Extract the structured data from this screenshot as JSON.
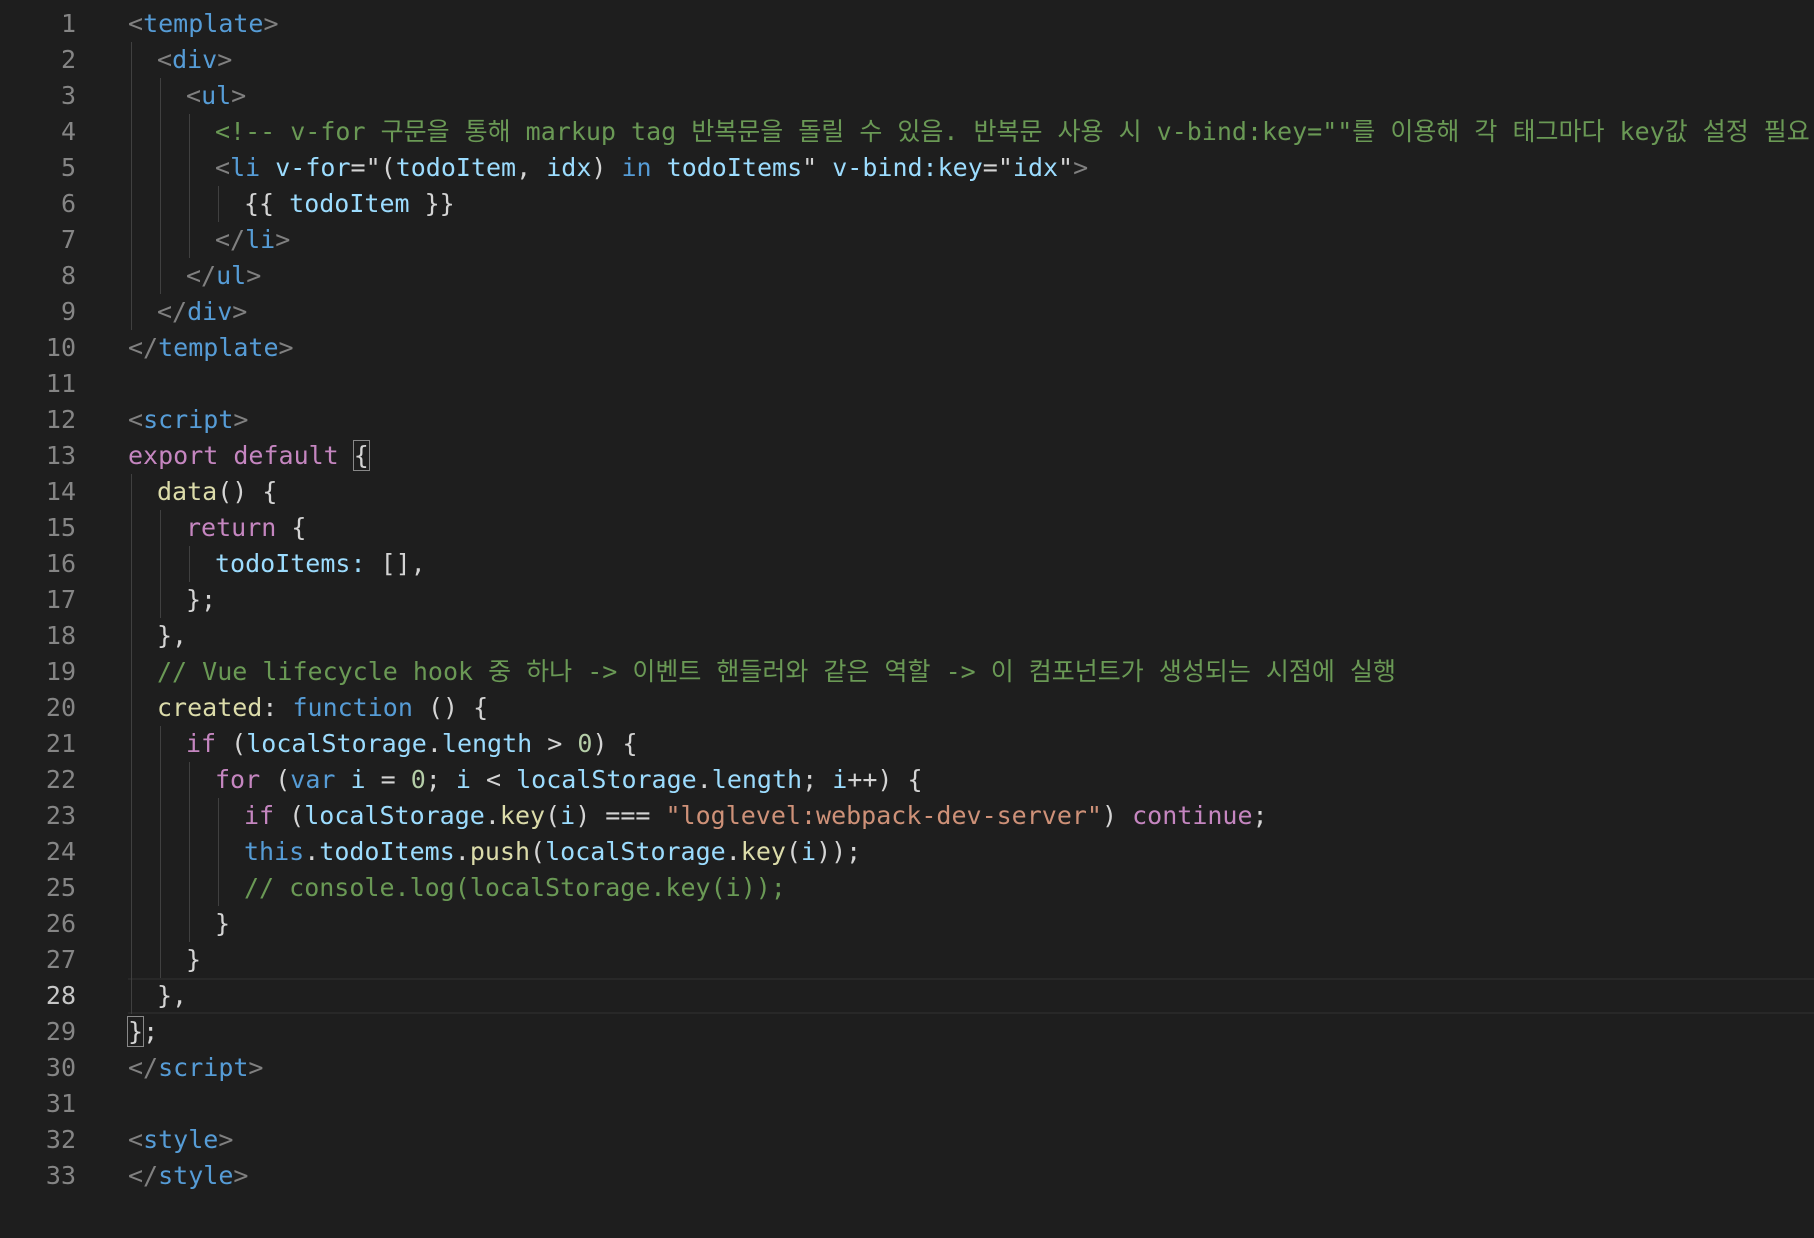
{
  "editor": {
    "language": "vue",
    "active_line": 28,
    "colors": {
      "background": "#1e1e1e",
      "line_number": "#858585",
      "tag": "#569cd6",
      "attribute": "#9cdcfe",
      "string": "#ce9178",
      "comment": "#6a9955",
      "keyword": "#c586c0",
      "function": "#dcdcaa"
    },
    "lines": [
      {
        "num": "1",
        "indent": 0,
        "tokens": [
          [
            "tag-p",
            "<"
          ],
          [
            "tag-n",
            "template"
          ],
          [
            "tag-p",
            ">"
          ]
        ]
      },
      {
        "num": "2",
        "indent": 1,
        "tokens": [
          [
            "tag-p",
            "<"
          ],
          [
            "tag-n",
            "div"
          ],
          [
            "tag-p",
            ">"
          ]
        ]
      },
      {
        "num": "3",
        "indent": 2,
        "tokens": [
          [
            "tag-p",
            "<"
          ],
          [
            "tag-n",
            "ul"
          ],
          [
            "tag-p",
            ">"
          ]
        ]
      },
      {
        "num": "4",
        "indent": 3,
        "tokens": [
          [
            "cmt",
            "<!-- v-for 구문을 통해 markup tag 반복문을 돌릴 수 있음. 반복문 사용 시 v-bind:key=\"\"를 이용해 각 태그마다 key값 설정 필요 -->"
          ]
        ]
      },
      {
        "num": "5",
        "indent": 3,
        "tokens": [
          [
            "tag-p",
            "<"
          ],
          [
            "tag-n",
            "li"
          ],
          [
            "txt",
            " "
          ],
          [
            "attr",
            "v-for"
          ],
          [
            "txt",
            "="
          ],
          [
            "txt",
            "\""
          ],
          [
            "txt",
            "("
          ],
          [
            "var",
            "todoItem"
          ],
          [
            "txt",
            ", "
          ],
          [
            "var",
            "idx"
          ],
          [
            "txt",
            ") "
          ],
          [
            "kw2",
            "in"
          ],
          [
            "txt",
            " "
          ],
          [
            "var",
            "todoItems"
          ],
          [
            "txt",
            "\""
          ],
          [
            "txt",
            " "
          ],
          [
            "attr",
            "v-bind:key"
          ],
          [
            "txt",
            "="
          ],
          [
            "txt",
            "\""
          ],
          [
            "var",
            "idx"
          ],
          [
            "txt",
            "\""
          ],
          [
            "tag-p",
            ">"
          ]
        ]
      },
      {
        "num": "6",
        "indent": 4,
        "tokens": [
          [
            "txt",
            "{{ "
          ],
          [
            "var",
            "todoItem"
          ],
          [
            "txt",
            " }}"
          ]
        ]
      },
      {
        "num": "7",
        "indent": 3,
        "tokens": [
          [
            "tag-p",
            "</"
          ],
          [
            "tag-n",
            "li"
          ],
          [
            "tag-p",
            ">"
          ]
        ]
      },
      {
        "num": "8",
        "indent": 2,
        "tokens": [
          [
            "tag-p",
            "</"
          ],
          [
            "tag-n",
            "ul"
          ],
          [
            "tag-p",
            ">"
          ]
        ]
      },
      {
        "num": "9",
        "indent": 1,
        "tokens": [
          [
            "tag-p",
            "</"
          ],
          [
            "tag-n",
            "div"
          ],
          [
            "tag-p",
            ">"
          ]
        ]
      },
      {
        "num": "10",
        "indent": 0,
        "tokens": [
          [
            "tag-p",
            "</"
          ],
          [
            "tag-n",
            "template"
          ],
          [
            "tag-p",
            ">"
          ]
        ]
      },
      {
        "num": "11",
        "indent": 0,
        "tokens": []
      },
      {
        "num": "12",
        "indent": 0,
        "tokens": [
          [
            "tag-p",
            "<"
          ],
          [
            "tag-n",
            "script"
          ],
          [
            "tag-p",
            ">"
          ]
        ]
      },
      {
        "num": "13",
        "indent": 0,
        "tokens": [
          [
            "kw",
            "export"
          ],
          [
            "txt",
            " "
          ],
          [
            "kw",
            "default"
          ],
          [
            "txt",
            " "
          ],
          [
            "box",
            "{"
          ]
        ]
      },
      {
        "num": "14",
        "indent": 1,
        "tokens": [
          [
            "fn",
            "data"
          ],
          [
            "txt",
            "() {"
          ]
        ]
      },
      {
        "num": "15",
        "indent": 2,
        "tokens": [
          [
            "kw",
            "return"
          ],
          [
            "txt",
            " {"
          ]
        ]
      },
      {
        "num": "16",
        "indent": 3,
        "tokens": [
          [
            "var",
            "todoItems"
          ],
          [
            "var",
            ":"
          ],
          [
            "txt",
            " [],"
          ]
        ]
      },
      {
        "num": "17",
        "indent": 2,
        "tokens": [
          [
            "txt",
            "};"
          ]
        ]
      },
      {
        "num": "18",
        "indent": 1,
        "tokens": [
          [
            "txt",
            "},"
          ]
        ]
      },
      {
        "num": "19",
        "indent": 1,
        "tokens": [
          [
            "cmt",
            "// Vue lifecycle hook 중 하나 -> 이벤트 핸들러와 같은 역할 -> 이 컴포넌트가 생성되는 시점에 실행"
          ]
        ]
      },
      {
        "num": "20",
        "indent": 1,
        "tokens": [
          [
            "fn",
            "created"
          ],
          [
            "txt",
            ": "
          ],
          [
            "kw2",
            "function"
          ],
          [
            "txt",
            " () {"
          ]
        ]
      },
      {
        "num": "21",
        "indent": 2,
        "tokens": [
          [
            "kw",
            "if"
          ],
          [
            "txt",
            " ("
          ],
          [
            "var",
            "localStorage"
          ],
          [
            "txt",
            "."
          ],
          [
            "var",
            "length"
          ],
          [
            "txt",
            " > "
          ],
          [
            "num",
            "0"
          ],
          [
            "txt",
            ") {"
          ]
        ]
      },
      {
        "num": "22",
        "indent": 3,
        "tokens": [
          [
            "kw",
            "for"
          ],
          [
            "txt",
            " ("
          ],
          [
            "kw2",
            "var"
          ],
          [
            "txt",
            " "
          ],
          [
            "var",
            "i"
          ],
          [
            "txt",
            " = "
          ],
          [
            "num",
            "0"
          ],
          [
            "txt",
            "; "
          ],
          [
            "var",
            "i"
          ],
          [
            "txt",
            " < "
          ],
          [
            "var",
            "localStorage"
          ],
          [
            "txt",
            "."
          ],
          [
            "var",
            "length"
          ],
          [
            "txt",
            "; "
          ],
          [
            "var",
            "i"
          ],
          [
            "txt",
            "++) {"
          ]
        ]
      },
      {
        "num": "23",
        "indent": 4,
        "tokens": [
          [
            "kw",
            "if"
          ],
          [
            "txt",
            " ("
          ],
          [
            "var",
            "localStorage"
          ],
          [
            "txt",
            "."
          ],
          [
            "fn",
            "key"
          ],
          [
            "txt",
            "("
          ],
          [
            "var",
            "i"
          ],
          [
            "txt",
            ") === "
          ],
          [
            "str",
            "\"loglevel:webpack-dev-server\""
          ],
          [
            "txt",
            ") "
          ],
          [
            "kw",
            "continue"
          ],
          [
            "txt",
            ";"
          ]
        ]
      },
      {
        "num": "24",
        "indent": 4,
        "tokens": [
          [
            "kw2",
            "this"
          ],
          [
            "txt",
            "."
          ],
          [
            "var",
            "todoItems"
          ],
          [
            "txt",
            "."
          ],
          [
            "fn",
            "push"
          ],
          [
            "txt",
            "("
          ],
          [
            "var",
            "localStorage"
          ],
          [
            "txt",
            "."
          ],
          [
            "fn",
            "key"
          ],
          [
            "txt",
            "("
          ],
          [
            "var",
            "i"
          ],
          [
            "txt",
            "));"
          ]
        ]
      },
      {
        "num": "25",
        "indent": 4,
        "tokens": [
          [
            "cmt",
            "// console.log(localStorage.key(i));"
          ]
        ]
      },
      {
        "num": "26",
        "indent": 3,
        "tokens": [
          [
            "txt",
            "}"
          ]
        ]
      },
      {
        "num": "27",
        "indent": 2,
        "tokens": [
          [
            "txt",
            "}"
          ]
        ]
      },
      {
        "num": "28",
        "indent": 1,
        "tokens": [
          [
            "txt",
            "},"
          ]
        ]
      },
      {
        "num": "29",
        "indent": 0,
        "tokens": [
          [
            "box",
            "}"
          ],
          [
            "txt",
            ";"
          ]
        ]
      },
      {
        "num": "30",
        "indent": 0,
        "tokens": [
          [
            "tag-p",
            "</"
          ],
          [
            "tag-n",
            "script"
          ],
          [
            "tag-p",
            ">"
          ]
        ]
      },
      {
        "num": "31",
        "indent": 0,
        "tokens": []
      },
      {
        "num": "32",
        "indent": 0,
        "tokens": [
          [
            "tag-p",
            "<"
          ],
          [
            "tag-n",
            "style"
          ],
          [
            "tag-p",
            ">"
          ]
        ]
      },
      {
        "num": "33",
        "indent": 0,
        "tokens": [
          [
            "tag-p",
            "</"
          ],
          [
            "tag-n",
            "style"
          ],
          [
            "tag-p",
            ">"
          ]
        ]
      }
    ]
  }
}
